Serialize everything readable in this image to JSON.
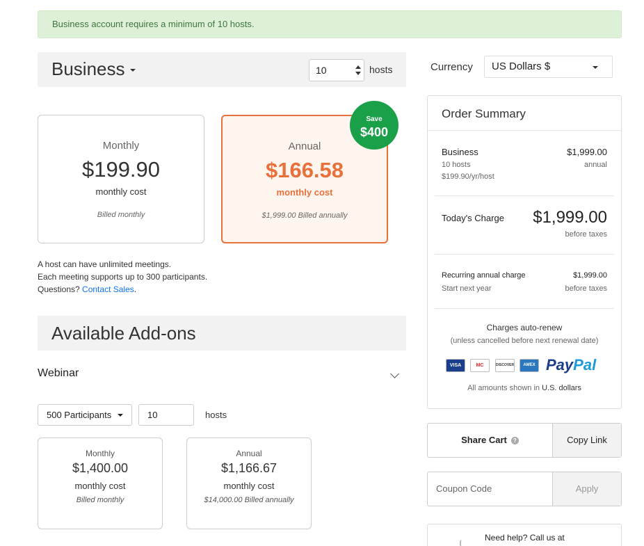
{
  "alert": {
    "message": "Business account requires a minimum of 10 hosts."
  },
  "plan": {
    "name": "Business",
    "hosts_value": "10",
    "hosts_label": "hosts"
  },
  "currency": {
    "label": "Currency",
    "selected": "US Dollars $"
  },
  "pricing": {
    "monthly": {
      "title": "Monthly",
      "price": "$199.90",
      "sub": "monthly cost",
      "note": "Billed monthly"
    },
    "annual": {
      "title": "Annual",
      "price": "$166.58",
      "sub": "monthly cost",
      "note": "$1,999.00 Billed annually",
      "selected": true
    },
    "save_badge": {
      "line1": "Save",
      "line2": "$400"
    }
  },
  "info": {
    "line1": "A host can have unlimited meetings.",
    "line2": "Each meeting supports up to 300 participants.",
    "questions": "Questions?",
    "contact_link": "Contact Sales",
    "period": "."
  },
  "addons": {
    "title": "Available Add-ons",
    "webinar": {
      "label": "Webinar",
      "participants": "500 Participants",
      "hosts_value": "10",
      "hosts_label": "hosts",
      "monthly": {
        "title": "Monthly",
        "price": "$1,400.00",
        "sub": "monthly cost",
        "note": "Billed monthly"
      },
      "annual": {
        "title": "Annual",
        "price": "$1,166.67",
        "sub": "monthly cost",
        "note": "$14,000.00 Billed annually"
      }
    }
  },
  "summary": {
    "title": "Order Summary",
    "item": {
      "name": "Business",
      "hosts": "10 hosts",
      "rate": "$199.90/yr/host",
      "price": "$1,999.00",
      "period": "annual"
    },
    "today": {
      "label": "Today's Charge",
      "amount": "$1,999.00",
      "note": "before taxes"
    },
    "recurring": {
      "label": "Recurring annual charge",
      "start": "Start next year",
      "amount": "$1,999.00",
      "note": "before taxes"
    },
    "auto_renew": "Charges auto-renew",
    "unless": "(unless cancelled before next renewal date)",
    "cards": [
      "VISA",
      "MC",
      "DISCOVER",
      "AMEX"
    ],
    "paypal_a": "Pay",
    "paypal_b": "Pal",
    "amounts_prefix": "All amounts shown in ",
    "amounts_currency": "U.S. dollars"
  },
  "share": {
    "label": "Share Cart",
    "copy": "Copy Link"
  },
  "coupon": {
    "placeholder": "Coupon Code",
    "apply": "Apply"
  },
  "help": {
    "text": "Need help? Call us at"
  },
  "colors": {
    "accent": "#e8703a",
    "save_green": "#1aa049",
    "link": "#0e72ed",
    "alert_bg": "#dff0d8"
  }
}
